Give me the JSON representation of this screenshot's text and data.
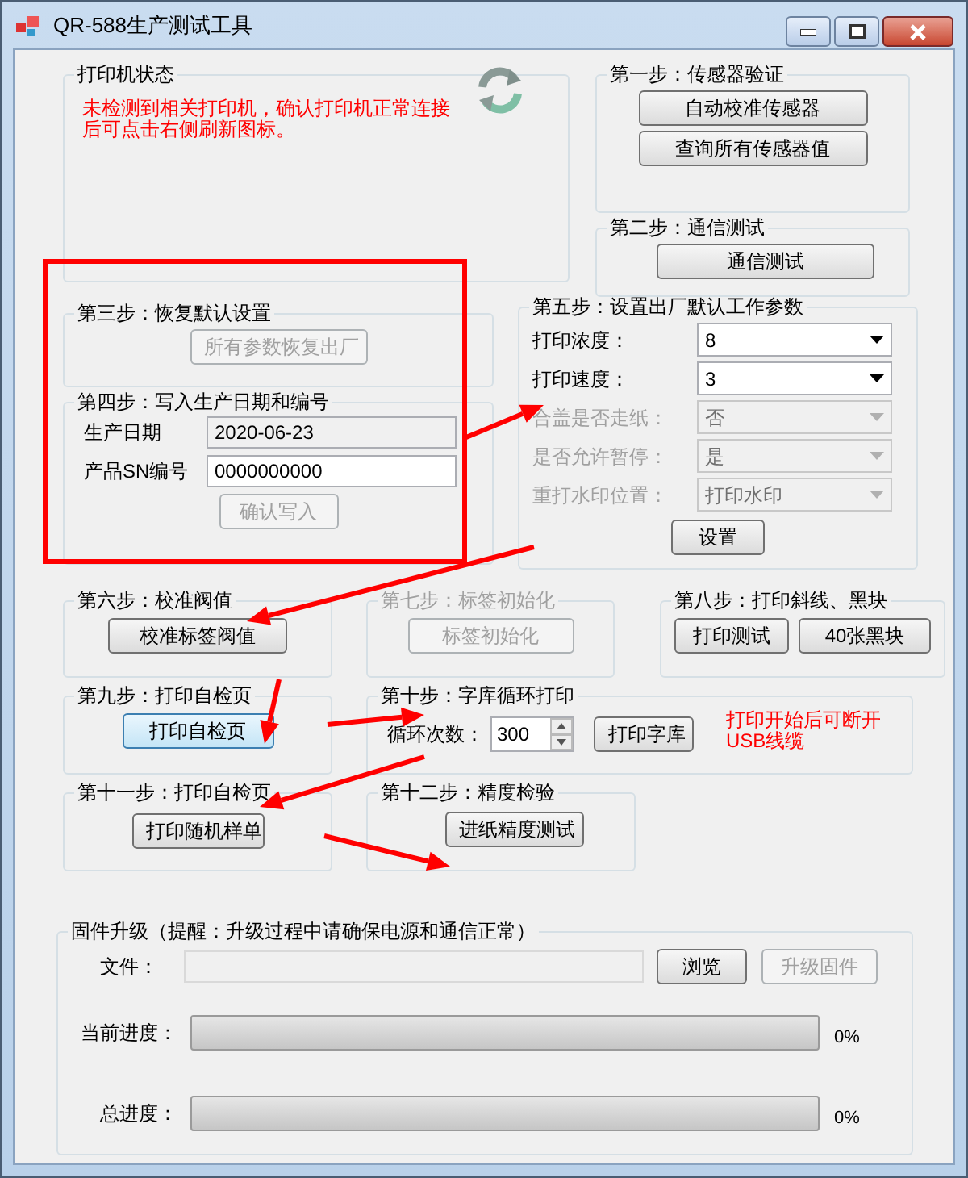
{
  "window": {
    "title": "QR-588生产测试工具"
  },
  "printer_status": {
    "title": "打印机状态",
    "message": "未检测到相关打印机，确认打印机正常连接后可点击右侧刷新图标。"
  },
  "groups": [
    {
      "title": "第一步：传感器验证",
      "disabled": false,
      "items": [
        {
          "kind": "button",
          "label": "自动校准传感器",
          "disabled": false,
          "focused": false
        },
        {
          "kind": "button",
          "label": "查询所有传感器值",
          "disabled": false,
          "focused": false
        }
      ]
    },
    {
      "title": "第二步：通信测试",
      "disabled": false,
      "items": [
        {
          "kind": "button",
          "label": "通信测试",
          "disabled": false,
          "focused": false
        }
      ]
    },
    {
      "title": "第三步：恢复默认设置",
      "disabled": false,
      "items": [
        {
          "kind": "button",
          "label": "所有参数恢复出厂",
          "disabled": true
        }
      ]
    },
    {
      "title": "第四步：写入生产日期和编号",
      "disabled": false,
      "items": [
        {
          "kind": "field",
          "label": "生产日期",
          "value": "2020-06-23",
          "readonly": true
        },
        {
          "kind": "field",
          "label": "产品SN编号",
          "value": "0000000000",
          "readonly": false
        },
        {
          "kind": "button",
          "label": "确认写入",
          "disabled": true
        }
      ]
    },
    {
      "title": "第五步：设置出厂默认工作参数",
      "disabled": false,
      "items": [
        {
          "kind": "select",
          "label": "打印浓度：",
          "value": "8",
          "disabled": false
        },
        {
          "kind": "select",
          "label": "打印速度：",
          "value": "3",
          "disabled": false
        },
        {
          "kind": "select",
          "label": "合盖是否走纸：",
          "value": "否",
          "disabled": true
        },
        {
          "kind": "select",
          "label": "是否允许暂停：",
          "value": "是",
          "disabled": true
        },
        {
          "kind": "select",
          "label": "重打水印位置：",
          "value": "打印水印",
          "disabled": true
        },
        {
          "kind": "button",
          "label": "设置",
          "disabled": false,
          "focused": false
        }
      ]
    },
    {
      "title": "第六步：校准阀值",
      "disabled": false,
      "items": [
        {
          "kind": "button",
          "label": "校准标签阀值",
          "disabled": false,
          "focused": false
        }
      ]
    },
    {
      "title": "第七步：标签初始化",
      "disabled": true,
      "items": [
        {
          "kind": "button",
          "label": "标签初始化",
          "disabled": true
        }
      ]
    },
    {
      "title": "第八步：打印斜线、黑块",
      "disabled": false,
      "items": [
        {
          "kind": "button",
          "label": "打印测试",
          "disabled": false,
          "focused": false
        },
        {
          "kind": "button",
          "label": "40张黑块",
          "disabled": false,
          "focused": false
        }
      ]
    },
    {
      "title": "第九步：打印自检页",
      "disabled": false,
      "items": [
        {
          "kind": "button",
          "label": "打印自检页",
          "disabled": false,
          "focused": true
        }
      ]
    },
    {
      "title": "第十步：字库循环打印",
      "disabled": false,
      "items": [
        {
          "kind": "spinner",
          "label": "循环次数：",
          "value": "300"
        },
        {
          "kind": "button",
          "label": "打印字库",
          "disabled": false,
          "focused": false
        },
        {
          "kind": "note",
          "text": "打印开始后可断开USB线缆"
        }
      ]
    },
    {
      "title": "第十一步：打印自检页",
      "disabled": false,
      "items": [
        {
          "kind": "button",
          "label": "打印随机样单",
          "disabled": false,
          "focused": false
        }
      ]
    },
    {
      "title": "第十二步：精度检验",
      "disabled": false,
      "items": [
        {
          "kind": "button",
          "label": "进纸精度测试",
          "disabled": false,
          "focused": false
        }
      ]
    }
  ],
  "firmware": {
    "title": "固件升级（提醒：升级过程中请确保电源和通信正常）",
    "file_label": "文件：",
    "buttons": [
      {
        "label": "浏览",
        "disabled": false
      },
      {
        "label": "升级固件",
        "disabled": true
      }
    ],
    "progress": [
      {
        "label": "当前进度：",
        "level": 0,
        "reading": "0%"
      },
      {
        "label": "总进度：",
        "level": 0,
        "reading": "0%"
      }
    ]
  }
}
